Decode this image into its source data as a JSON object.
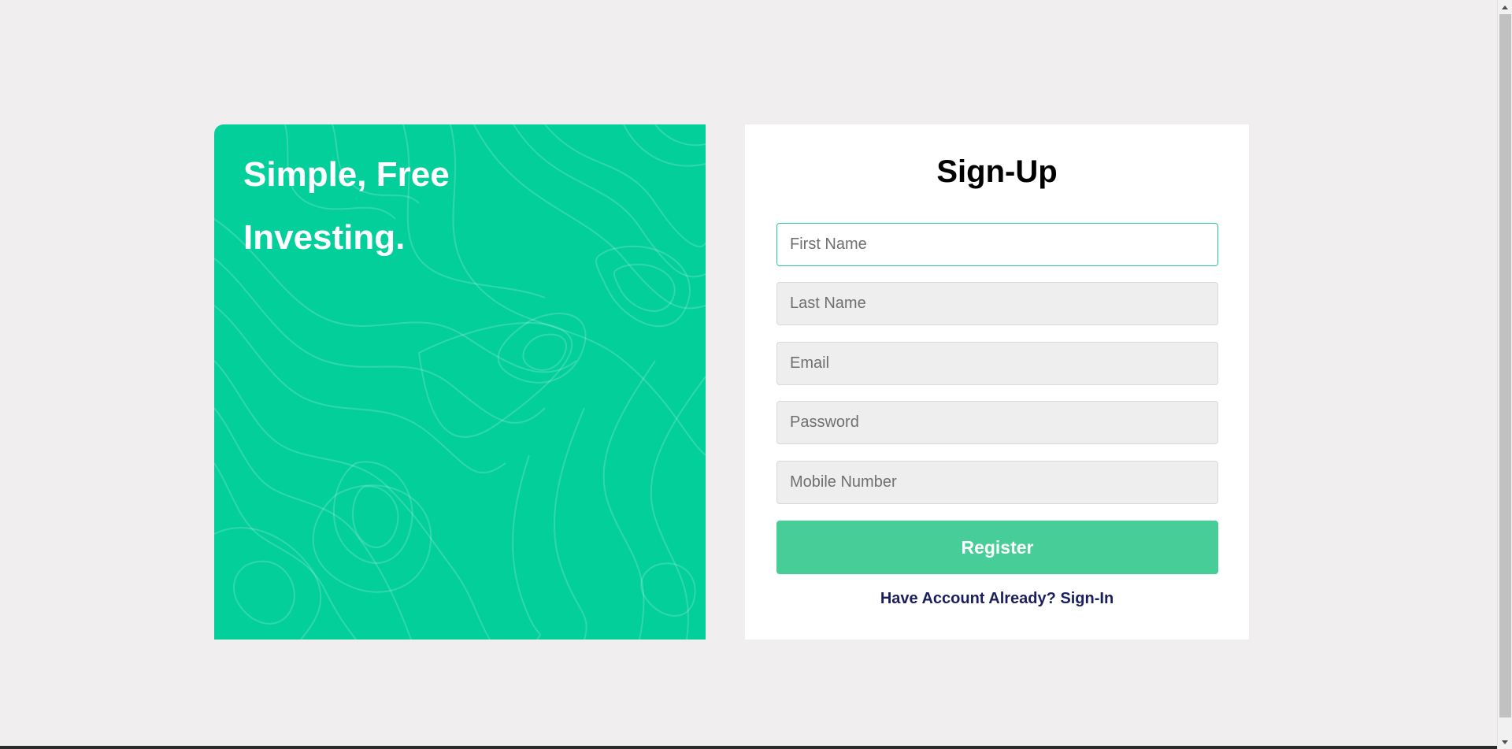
{
  "promo": {
    "headline": "Simple, Free Investing.",
    "background_color": "#03cf9b"
  },
  "signup": {
    "title": "Sign-Up",
    "fields": {
      "first_name_placeholder": "First Name",
      "last_name_placeholder": "Last Name",
      "email_placeholder": "Email",
      "password_placeholder": "Password",
      "mobile_placeholder": "Mobile Number"
    },
    "register_label": "Register",
    "signin_link_label": "Have Account Already? Sign-In",
    "accent_color": "#46cd98",
    "link_color": "#1a1f5c"
  },
  "scrollbar": {
    "up_icon": "arrow-up-icon",
    "down_icon": "arrow-down-icon"
  }
}
